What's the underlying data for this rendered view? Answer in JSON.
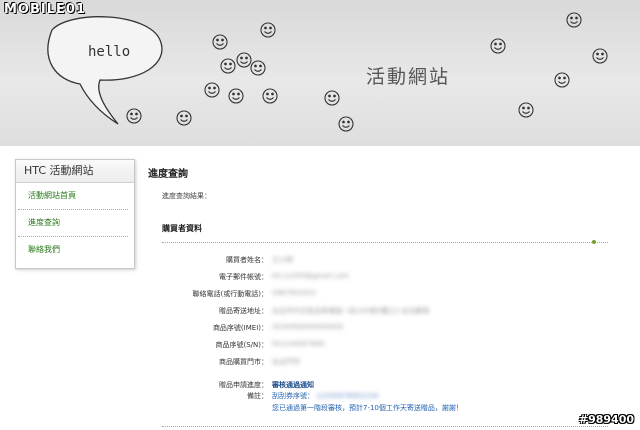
{
  "watermark": {
    "logo": "MOBILE01",
    "code": "#989400"
  },
  "banner": {
    "site_title": "活動網站",
    "bubble_text": "hello"
  },
  "sidebar": {
    "title": "HTC 活動網站",
    "items": [
      {
        "label": "活動網站首頁"
      },
      {
        "label": "進度查詢"
      },
      {
        "label": "聯絡我們"
      }
    ]
  },
  "main": {
    "title": "進度查詢",
    "progress_label": "進度查詢結果：",
    "section_title": "購買者資料",
    "rows": [
      {
        "label": "購買者姓名：",
        "value": "王小明"
      },
      {
        "label": "電子郵件帳號：",
        "value": "htc12345@gmail.com"
      },
      {
        "label": "聯絡電話(或行動電話)：",
        "value": "0987654321"
      },
      {
        "label": "贈品寄送地址：",
        "value": "台北市中正區忠孝東路一段100號5樓之3 台北郵局"
      },
      {
        "label": "商品序號(IMEI)：",
        "value": "3534560000000000"
      },
      {
        "label": "商品序號(S/N)：",
        "value": "FA1234567890"
      },
      {
        "label": "商品購買門市：",
        "value": "台北門市"
      },
      {
        "label": "贈品申請進度：",
        "value": "審核通過通知"
      },
      {
        "label": "備註：",
        "value_prefix": "刮刮券序號：",
        "value": "12345678901234"
      }
    ],
    "notice": "您已通過第一階段審核，預計7-10個工作天寄送贈品，謝謝！"
  }
}
